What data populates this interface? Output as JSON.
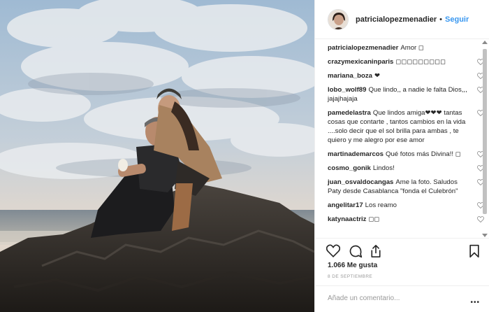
{
  "post": {
    "username": "patricialopezmenadier",
    "separator": "•",
    "follow_label": "Seguir"
  },
  "comments": [
    {
      "user": "patricialopezmenadier",
      "text": "Amor ◻",
      "heart": false
    },
    {
      "user": "crazymexicaninparis",
      "text": "◻◻◻◻◻◻◻◻◻",
      "heart": true
    },
    {
      "user": "mariana_boza",
      "text": "❤",
      "heart": true
    },
    {
      "user": "lobo_wolf89",
      "text": "Que lindo,, a nadie le falta Dios,,, jajajhajaja",
      "heart": true
    },
    {
      "user": "pamedelastra",
      "text": "Que lindos amiga❤❤❤ tantas cosas que contarte , tantos cambios en la vida ....solo decir que el sol brilla para ambas , te quiero y me alegro por ese amor",
      "heart": true
    },
    {
      "user": "martinademarcos",
      "text": "Qué fotos más Divina!! ◻",
      "heart": true
    },
    {
      "user": "cosmo_gonik",
      "text": "Lindos!",
      "heart": true
    },
    {
      "user": "juan_osvaldocangas",
      "text": "Ame la foto. Saludos Paty desde Casablanca \"fonda el Culebrón\"",
      "heart": true
    },
    {
      "user": "angelitar17",
      "text": "Los reamo",
      "heart": true
    },
    {
      "user": "katynaactriz",
      "text": "◻◻",
      "heart": true
    }
  ],
  "likes_text": "1.066 Me gusta",
  "date_text": "8 DE SEPTIEMBRE",
  "add_comment_placeholder": "Añade un comentario...",
  "more_label": "•••",
  "icons": {
    "like": "heart-icon",
    "comment": "comment-icon",
    "share": "share-icon",
    "save": "bookmark-icon"
  },
  "colors": {
    "link": "#3897f0",
    "text": "#262626",
    "muted": "#999999"
  }
}
